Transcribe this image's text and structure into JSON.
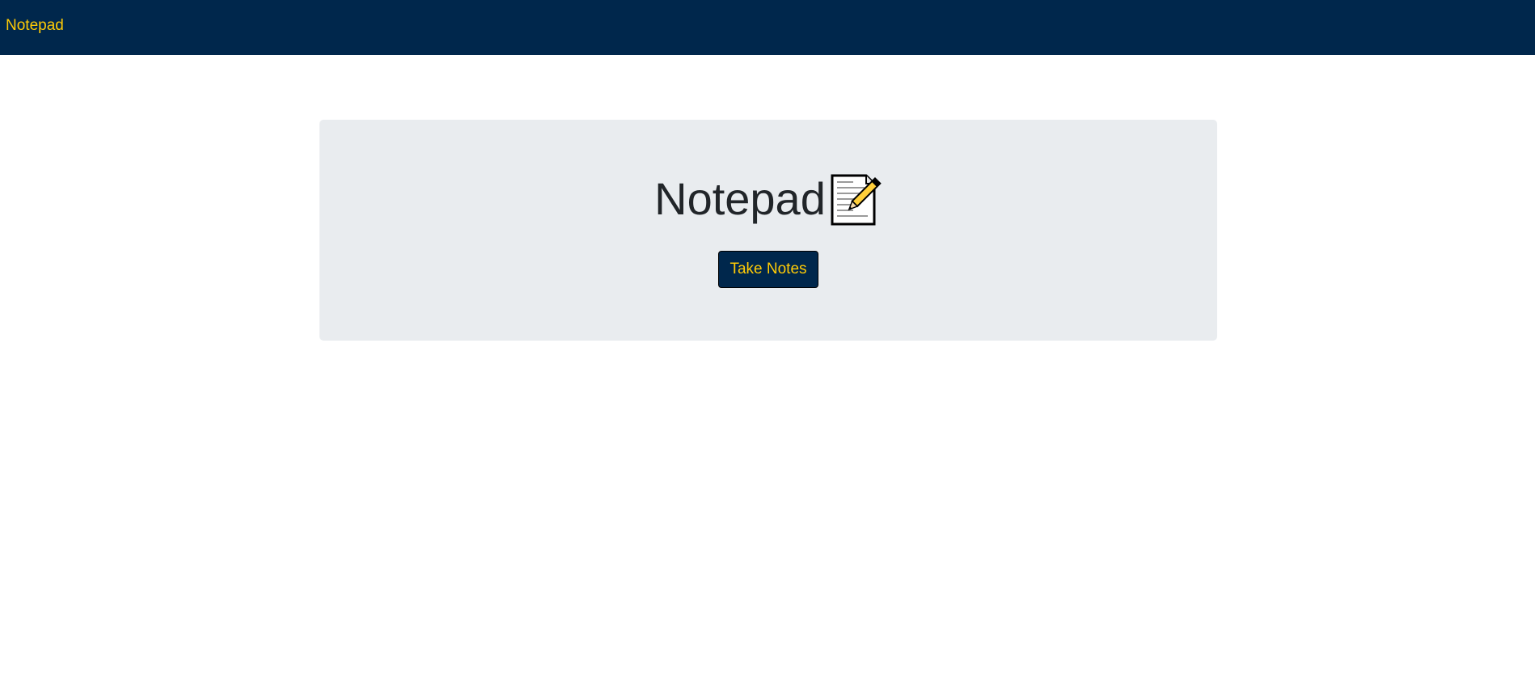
{
  "navbar": {
    "brand": "Notepad"
  },
  "hero": {
    "title": "Notepad",
    "icon": "memo-icon",
    "button_label": "Take Notes"
  },
  "colors": {
    "navbar_bg": "#00274c",
    "accent": "#ffcb05",
    "panel_bg": "#e9ecef",
    "title_text": "#212529"
  }
}
